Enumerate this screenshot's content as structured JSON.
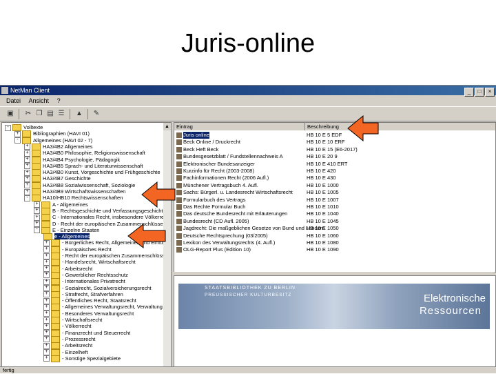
{
  "slide": {
    "title": "Juris-online"
  },
  "window": {
    "title": "NetMan Client"
  },
  "menu": [
    "Datei",
    "Ansicht",
    "?"
  ],
  "tree": [
    {
      "label": "Volltexte",
      "level": 0,
      "exp": "-"
    },
    {
      "label": "Bibliographien (HAVI 01)",
      "level": 1,
      "exp": "+"
    },
    {
      "label": "Allgemeines (HAVI 02 - 7)",
      "level": 1,
      "exp": "-"
    },
    {
      "label": "HA3/4B2 Allgemeines",
      "level": 2,
      "exp": "+"
    },
    {
      "label": "HA3/4B0 Philosophie, Religionswissenschaft",
      "level": 2,
      "exp": "+"
    },
    {
      "label": "HA3/4B4 Psychologie, Pädagogik",
      "level": 2,
      "exp": "+"
    },
    {
      "label": "HA3/4B5 Sprach- und Literaturwissenschaft",
      "level": 2,
      "exp": "+"
    },
    {
      "label": "HA3/4B0 Kunst, Vorgeschichte und Frühgeschichte",
      "level": 2,
      "exp": "+"
    },
    {
      "label": "HA3/4B7 Geschichte",
      "level": 2,
      "exp": "+"
    },
    {
      "label": "HA3/4B8 Sozialwissenschaft, Soziologie",
      "level": 2,
      "exp": "+"
    },
    {
      "label": "HA3/4B9 Wirtschaftswissenschaften",
      "level": 2,
      "exp": "+"
    },
    {
      "label": "HA10/HB10 Rechtswissenschaften",
      "level": 2,
      "exp": "-"
    },
    {
      "label": "A - Allgemeines",
      "level": 3,
      "exp": "+"
    },
    {
      "label": "B - Rechtsgeschichte und Verfassungsgeschichte",
      "level": 3,
      "exp": "+"
    },
    {
      "label": "C - Internationales Recht, insbesondere Völkerrecht",
      "level": 3,
      "exp": "+"
    },
    {
      "label": "D - Recht der europäischen Zusammenschlüsse",
      "level": 3,
      "exp": "+"
    },
    {
      "label": "E - Einzelne Staaten",
      "level": 3,
      "exp": "-"
    },
    {
      "label": "e - Allgemeines",
      "level": 4,
      "exp": "",
      "selected": true
    },
    {
      "label": "- Bürgerliches Recht, Allgemeines und Einführung",
      "level": 4,
      "exp": "+"
    },
    {
      "label": "- Europäisches Recht",
      "level": 4,
      "exp": "+"
    },
    {
      "label": "- Recht der europäischen Zusammenschlüsse",
      "level": 4,
      "exp": "+"
    },
    {
      "label": "- Handelsrecht, Wirtschaftsrecht",
      "level": 4,
      "exp": "+"
    },
    {
      "label": "- Arbeitsrecht",
      "level": 4,
      "exp": "+"
    },
    {
      "label": "- Gewerblicher Rechtsschutz",
      "level": 4,
      "exp": "+"
    },
    {
      "label": "- Internationales Privatrecht",
      "level": 4,
      "exp": "+"
    },
    {
      "label": "- Sozialrecht, Sozialversicherungsrecht",
      "level": 4,
      "exp": "+"
    },
    {
      "label": "- Strafrecht, Strafverfahren",
      "level": 4,
      "exp": "+"
    },
    {
      "label": "- Öffentliches Recht, Staatsrecht",
      "level": 4,
      "exp": "+"
    },
    {
      "label": "- Allgemeines Verwaltungsrecht, Verwaltung",
      "level": 4,
      "exp": "+"
    },
    {
      "label": "- Besonderes Verwaltungsrecht",
      "level": 4,
      "exp": "+"
    },
    {
      "label": "- Wirtschaftsrecht",
      "level": 4,
      "exp": "+"
    },
    {
      "label": "- Völkerrecht",
      "level": 4,
      "exp": "+"
    },
    {
      "label": "- Finanzrecht und Steuerrecht",
      "level": 4,
      "exp": "+"
    },
    {
      "label": "- Prozessrecht",
      "level": 4,
      "exp": "+"
    },
    {
      "label": "- Arbeitsrecht",
      "level": 4,
      "exp": "+"
    },
    {
      "label": "- Einzelheft",
      "level": 4,
      "exp": "+"
    },
    {
      "label": "- Sonstige Spezialgebiete",
      "level": 4,
      "exp": "+"
    }
  ],
  "list": {
    "col_name": "Eintrag",
    "col_desc": "Beschreibung",
    "rows": [
      {
        "name": "Juris online",
        "desc": "HB 10 E 5 EDF",
        "selected": true
      },
      {
        "name": "Beck Online / Druckrecht",
        "desc": "HB 10 E 10 ERF"
      },
      {
        "name": "Beck Heft Beck",
        "desc": "HB 10 E 15 (E6-2017)"
      },
      {
        "name": "Bundesgesetzblatt / Fundstellennachweis A",
        "desc": "HB 10 E 20 9"
      },
      {
        "name": "Elektronischer Bundesanzeiger",
        "desc": "HB 10 E 410 ERT"
      },
      {
        "name": "Kurzinfo für Recht (2003-2008)",
        "desc": "HB 10 E 420"
      },
      {
        "name": "Fachinformationen Recht (2006 Aufl.)",
        "desc": "HB 10 E 430"
      },
      {
        "name": "Münchener Vertragsbuch 4. Aufl.",
        "desc": "HB 10 E 1000"
      },
      {
        "name": "Sachs: Bürgerl. u. Landesrecht Wirtschaftsrecht",
        "desc": "HB 10 E 1005"
      },
      {
        "name": "Formularbuch des Vertrags",
        "desc": "HB 10 E 1007"
      },
      {
        "name": "Das Rechte Formular Buch",
        "desc": "HB 10 E 1010"
      },
      {
        "name": "Das deutsche Bundesrecht mit Erläuterungen",
        "desc": "HB 10 E 1040"
      },
      {
        "name": "Bundesrecht (CD Aufl. 2005)",
        "desc": "HB 10 E 1045"
      },
      {
        "name": "Jagdrecht: Die maßgeblichen Gesetze von Bund und Ländern",
        "desc": "HB 10 E 1050"
      },
      {
        "name": "Deutsche Rechtsprechung (03/2005)",
        "desc": "HB 10 E 1060"
      },
      {
        "name": "Lexikon des Verwaltungsrechts (4. Aufl.)",
        "desc": "HB 10 E 1080"
      },
      {
        "name": "OLG-Report Plus (Edition 10)",
        "desc": "HB 10 E 1090"
      }
    ]
  },
  "banner": {
    "org_line1": "STAATSBIBLIOTHEK ZU BERLIN",
    "org_line2": "PREUSSISCHER KULTURBESITZ",
    "title_line1": "Elektronische",
    "title_line2": "Ressourcen"
  },
  "status": "fertig",
  "colors": {
    "arrow_fill": "#f26522",
    "arrow_stroke": "#000000",
    "selection": "#0a246a",
    "titlebar": "#0a246a"
  }
}
